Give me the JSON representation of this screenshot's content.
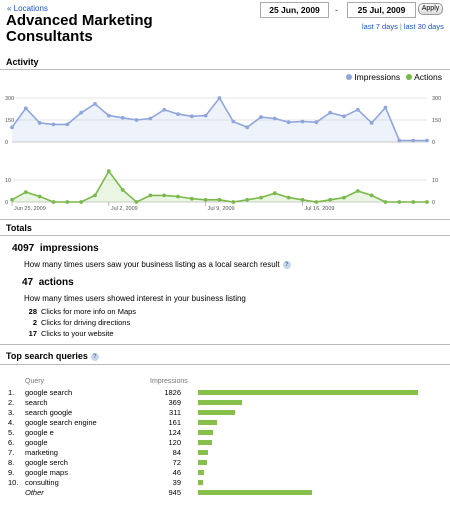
{
  "header": {
    "back_link": "« Locations",
    "business_name": "Advanced Marketing Consultants",
    "date_from": "25 Jun, 2009",
    "date_to": "25 Jul, 2009",
    "date_separator": "-",
    "apply_label": "Apply",
    "quick_ranges": [
      "last 7 days",
      "last 30 days"
    ],
    "quick_separator": "|"
  },
  "activity": {
    "title": "Activity",
    "legend": [
      {
        "label": "Impressions",
        "color": "#8fa6dc"
      },
      {
        "label": "Actions",
        "color": "#7ab94a"
      }
    ]
  },
  "chart_data": [
    {
      "type": "area",
      "name": "Impressions",
      "color": "#8fa6dc",
      "ylim": [
        0,
        300
      ],
      "yticks": [
        "300",
        "150",
        "0"
      ],
      "values": [
        100,
        230,
        130,
        120,
        120,
        200,
        260,
        180,
        165,
        150,
        160,
        220,
        190,
        175,
        180,
        300,
        140,
        100,
        170,
        160,
        135,
        140,
        135,
        200,
        175,
        220,
        130,
        235,
        10,
        10,
        10
      ]
    },
    {
      "type": "area",
      "name": "Actions",
      "color": "#7ab94a",
      "ylim": [
        0,
        10
      ],
      "yticks": [
        "10",
        "0"
      ],
      "values": [
        1,
        4.5,
        2.5,
        0,
        0,
        0,
        3,
        14,
        5.5,
        0,
        3,
        3,
        2.5,
        1.5,
        1,
        1,
        0,
        1,
        2,
        4,
        2,
        1,
        0,
        1,
        2,
        5,
        3,
        0,
        0,
        0,
        0
      ],
      "x_tick_labels": [
        "Jun 25, 2009",
        "Jul 2, 2009",
        "Jul 9, 2009",
        "Jul 16, 2009"
      ]
    }
  ],
  "totals": {
    "title": "Totals",
    "impressions_count": "4097",
    "impressions_label": "impressions",
    "impressions_desc": "How many times users saw your business listing as a local search result",
    "actions_count": "47",
    "actions_label": "actions",
    "actions_desc": "How many times users showed interest in your business listing",
    "action_breakdown": [
      {
        "count": "28",
        "label": "Clicks for more info on Maps"
      },
      {
        "count": "2",
        "label": "Clicks for driving directions"
      },
      {
        "count": "17",
        "label": "Clicks to your website"
      }
    ]
  },
  "queries": {
    "title": "Top search queries",
    "col_query": "Query",
    "col_impressions": "Impressions",
    "max_value": 1826,
    "rows": [
      {
        "rank": "1.",
        "query": "google search",
        "impressions": 1826
      },
      {
        "rank": "2.",
        "query": "search",
        "impressions": 369
      },
      {
        "rank": "3.",
        "query": "search google",
        "impressions": 311
      },
      {
        "rank": "4.",
        "query": "google search engine",
        "impressions": 161
      },
      {
        "rank": "5.",
        "query": "google e",
        "impressions": 124
      },
      {
        "rank": "6.",
        "query": "google",
        "impressions": 120
      },
      {
        "rank": "7.",
        "query": "marketing",
        "impressions": 84
      },
      {
        "rank": "8.",
        "query": "google serch",
        "impressions": 72
      },
      {
        "rank": "9.",
        "query": "google maps",
        "impressions": 46
      },
      {
        "rank": "10.",
        "query": "consulting",
        "impressions": 39
      },
      {
        "rank": "",
        "query": "Other",
        "impressions": 945
      }
    ]
  }
}
